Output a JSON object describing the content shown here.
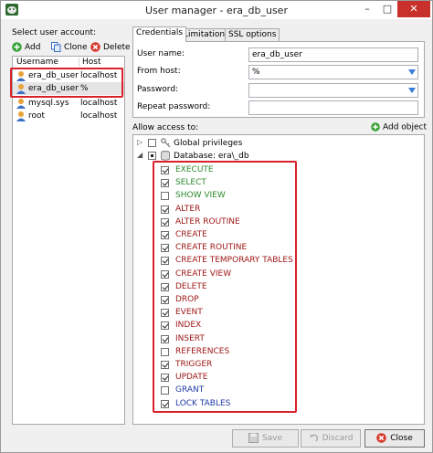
{
  "window": {
    "title": "User manager - era_db_user",
    "minimize": "–",
    "maximize": "□",
    "close": "✕"
  },
  "left": {
    "label": "Select user account:",
    "toolbar": {
      "add": "Add",
      "clone": "Clone",
      "delete": "Delete"
    },
    "columns": {
      "username": "Username",
      "host": "Host"
    },
    "users": [
      {
        "username": "era_db_user",
        "host": "localhost"
      },
      {
        "username": "era_db_user",
        "host": "%"
      },
      {
        "username": "mysql.sys",
        "host": "localhost"
      },
      {
        "username": "root",
        "host": "localhost"
      }
    ]
  },
  "tabs": [
    "Credentials",
    "Limitations",
    "SSL options"
  ],
  "credentials": {
    "user_name_label": "User name:",
    "user_name": "era_db_user",
    "from_host_label": "From host:",
    "from_host": "%",
    "password_label": "Password:",
    "password": "",
    "repeat_password_label": "Repeat password:",
    "repeat_password": ""
  },
  "access": {
    "label": "Allow access to:",
    "add_object": "Add object",
    "global": "Global privileges",
    "database": "Database: era\\_db",
    "privileges": [
      {
        "name": "EXECUTE",
        "checked": true,
        "color": "green"
      },
      {
        "name": "SELECT",
        "checked": true,
        "color": "green"
      },
      {
        "name": "SHOW VIEW",
        "checked": false,
        "color": "green"
      },
      {
        "name": "ALTER",
        "checked": true,
        "color": "red"
      },
      {
        "name": "ALTER ROUTINE",
        "checked": true,
        "color": "red"
      },
      {
        "name": "CREATE",
        "checked": true,
        "color": "red"
      },
      {
        "name": "CREATE ROUTINE",
        "checked": true,
        "color": "red"
      },
      {
        "name": "CREATE TEMPORARY TABLES",
        "checked": true,
        "color": "red"
      },
      {
        "name": "CREATE VIEW",
        "checked": true,
        "color": "red"
      },
      {
        "name": "DELETE",
        "checked": true,
        "color": "red"
      },
      {
        "name": "DROP",
        "checked": true,
        "color": "red"
      },
      {
        "name": "EVENT",
        "checked": true,
        "color": "red"
      },
      {
        "name": "INDEX",
        "checked": true,
        "color": "red"
      },
      {
        "name": "INSERT",
        "checked": true,
        "color": "red"
      },
      {
        "name": "REFERENCES",
        "checked": false,
        "color": "red"
      },
      {
        "name": "TRIGGER",
        "checked": true,
        "color": "red"
      },
      {
        "name": "UPDATE",
        "checked": true,
        "color": "red"
      },
      {
        "name": "GRANT",
        "checked": false,
        "color": "blue"
      },
      {
        "name": "LOCK TABLES",
        "checked": true,
        "color": "blue"
      }
    ]
  },
  "buttons": {
    "save": "Save",
    "discard": "Discard",
    "close": "Close"
  },
  "colors": {
    "highlight": "#d9212b",
    "grant_green": "#2c8a2c",
    "grant_red": "#a01818",
    "grant_blue": "#1f3aa6",
    "title_close": "#c7302b"
  },
  "icons": {
    "app": "dolphin-app-icon",
    "add": "green-plus-icon",
    "clone": "clone-icon",
    "delete": "red-x-icon",
    "user": "user-icon",
    "key": "key-icon",
    "database": "database-icon",
    "save": "save-icon",
    "discard": "discard-icon",
    "close": "red-x-icon"
  }
}
